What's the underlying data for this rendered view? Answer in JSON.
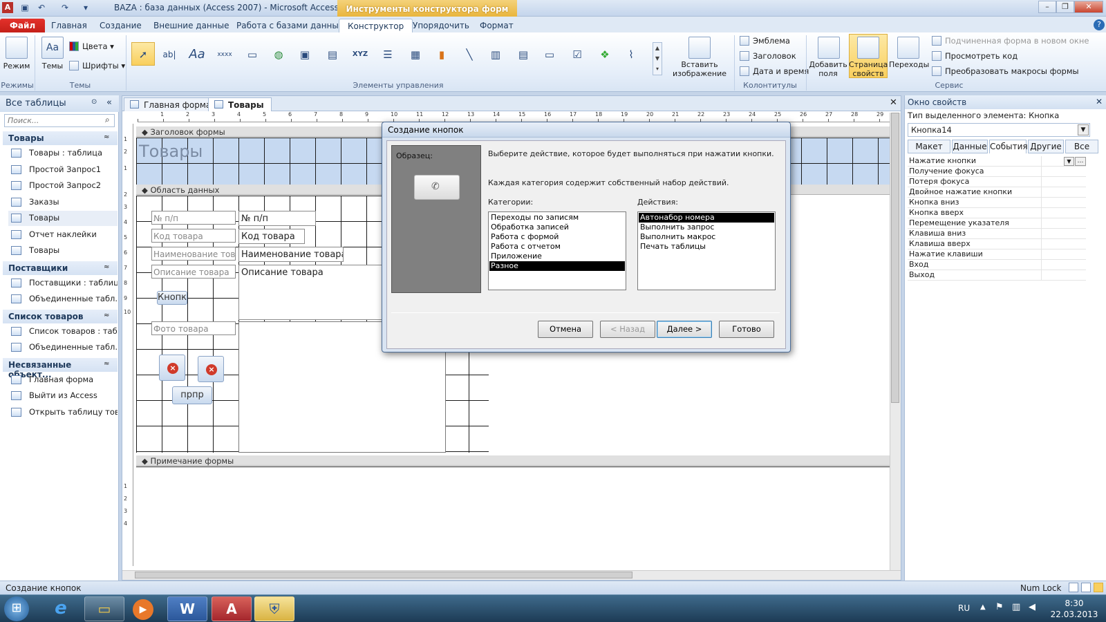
{
  "window": {
    "title": "BAZA : база данных (Access 2007)  -  Microsoft Access",
    "context_tab": "Инструменты конструктора форм",
    "app_badge": "A"
  },
  "ribbon_tabs": [
    {
      "label": "Файл"
    },
    {
      "label": "Главная"
    },
    {
      "label": "Создание"
    },
    {
      "label": "Внешние данные"
    },
    {
      "label": "Работа с базами данных"
    },
    {
      "label": "Конструктор"
    },
    {
      "label": "Упорядочить"
    },
    {
      "label": "Формат"
    }
  ],
  "ribbon": {
    "mode_label": "Режим",
    "modes_group": "Режимы",
    "themes_label": "Темы",
    "colors_label": "Цвета",
    "fonts_label": "Шрифты",
    "themes_group": "Темы",
    "controls_group": "Элементы управления",
    "insert_image": "Вставить изображение",
    "emblem": "Эмблема",
    "header": "Заголовок",
    "datetime": "Дата и время",
    "headers_group": "Колонтитулы",
    "add_fields": "Добавить поля",
    "prop_sheet": "Страница свойств",
    "transitions": "Переходы",
    "subform_new_window": "Подчиненная форма в новом окне",
    "view_code": "Просмотреть код",
    "convert_macros": "Преобразовать макросы формы",
    "service_group": "Сервис",
    "tool_text_aa": "Aa",
    "tool_abl": "ab|",
    "tool_xxxx": "xxxx",
    "tool_xyz": "XYZ"
  },
  "nav": {
    "header": "Все таблицы",
    "search_placeholder": "Поиск...",
    "groups": [
      {
        "title": "Товары",
        "items": [
          "Товары : таблица",
          "Простой Запрос1",
          "Простой Запрос2",
          "Заказы",
          "Товары",
          "Отчет наклейки",
          "Товары"
        ]
      },
      {
        "title": "Поставщики",
        "items": [
          "Поставщики : таблица",
          "Объединенные табл..."
        ]
      },
      {
        "title": "Список товаров",
        "items": [
          "Список товаров : таб...",
          "Объединенные табл..."
        ]
      },
      {
        "title": "Несвязанные объект...",
        "items": [
          "Главная форма",
          "Выйти из Access",
          "Открыть таблицу тов..."
        ]
      }
    ]
  },
  "doc": {
    "tabs": [
      "Главная форма",
      "Товары"
    ],
    "section_header": "Заголовок формы",
    "section_detail": "Область данных",
    "section_footer": "Примечание формы",
    "form_title": "Товары",
    "labels": [
      "№ п/п",
      "Код товара",
      "Наименование товара",
      "Описание товара",
      "Фото товара"
    ],
    "fields": [
      "№ п/п",
      "Код товара",
      "Наименование товара",
      "Описание товара"
    ],
    "button_kn": "Кнопк",
    "button_prpr": "прпр",
    "x_glyph": "×",
    "ruler_numbers": [
      "1",
      "2",
      "3",
      "4",
      "5",
      "6",
      "7",
      "8",
      "9",
      "10",
      "11",
      "12",
      "13",
      "14",
      "15",
      "16",
      "17",
      "18",
      "19",
      "20",
      "21",
      "22",
      "23",
      "24",
      "25",
      "26",
      "27",
      "28",
      "29"
    ],
    "vruler_numbers": [
      "1",
      "2",
      "1",
      "2",
      "3",
      "4",
      "5",
      "6",
      "7",
      "8",
      "9",
      "10",
      "1",
      "2",
      "3",
      "4"
    ]
  },
  "dialog": {
    "title": "Создание кнопок",
    "sample_label": "Образец:",
    "sample_icon": "✆",
    "intro1": "Выберите действие, которое будет выполняться при нажатии кнопки.",
    "intro2": "Каждая категория содержит собственный набор действий.",
    "categories_label": "Категории:",
    "actions_label": "Действия:",
    "categories": [
      "Переходы по записям",
      "Обработка записей",
      "Работа с формой",
      "Работа с отчетом",
      "Приложение",
      "Разное"
    ],
    "categories_selected": 5,
    "actions": [
      "Автонабор номера",
      "Выполнить запрос",
      "Выполнить макрос",
      "Печать таблицы"
    ],
    "actions_selected": 0,
    "btn_cancel": "Отмена",
    "btn_back": "< Назад",
    "btn_next": "Далее >",
    "btn_finish": "Готово"
  },
  "props": {
    "title": "Окно свойств",
    "selection_type_label": "Тип выделенного элемента:  Кнопка",
    "object_value": "Кнопка14",
    "tabs": [
      "Макет",
      "Данные",
      "События",
      "Другие",
      "Все"
    ],
    "active_tab": 2,
    "rows": [
      "Нажатие кнопки",
      "Получение фокуса",
      "Потеря фокуса",
      "Двойное нажатие кнопки",
      "Кнопка вниз",
      "Кнопка вверх",
      "Перемещение указателя",
      "Клавиша вниз",
      "Клавиша вверх",
      "Нажатие клавиши",
      "Вход",
      "Выход"
    ]
  },
  "status": {
    "left": "Создание кнопок",
    "numlock": "Num Lock"
  },
  "taskbar": {
    "lang": "RU",
    "time": "8:30",
    "date": "22.03.2013",
    "start_icon": "⊞",
    "ie_icon": "e",
    "folder_icon": "▭",
    "media_icon": "▶",
    "word_icon": "W",
    "access_icon": "A",
    "shield_icon": "⛨"
  },
  "colors": {
    "accent": "#2b579a",
    "file_tab": "#c31f18",
    "context_tab": "#e9b53d",
    "selection": "#000000"
  }
}
